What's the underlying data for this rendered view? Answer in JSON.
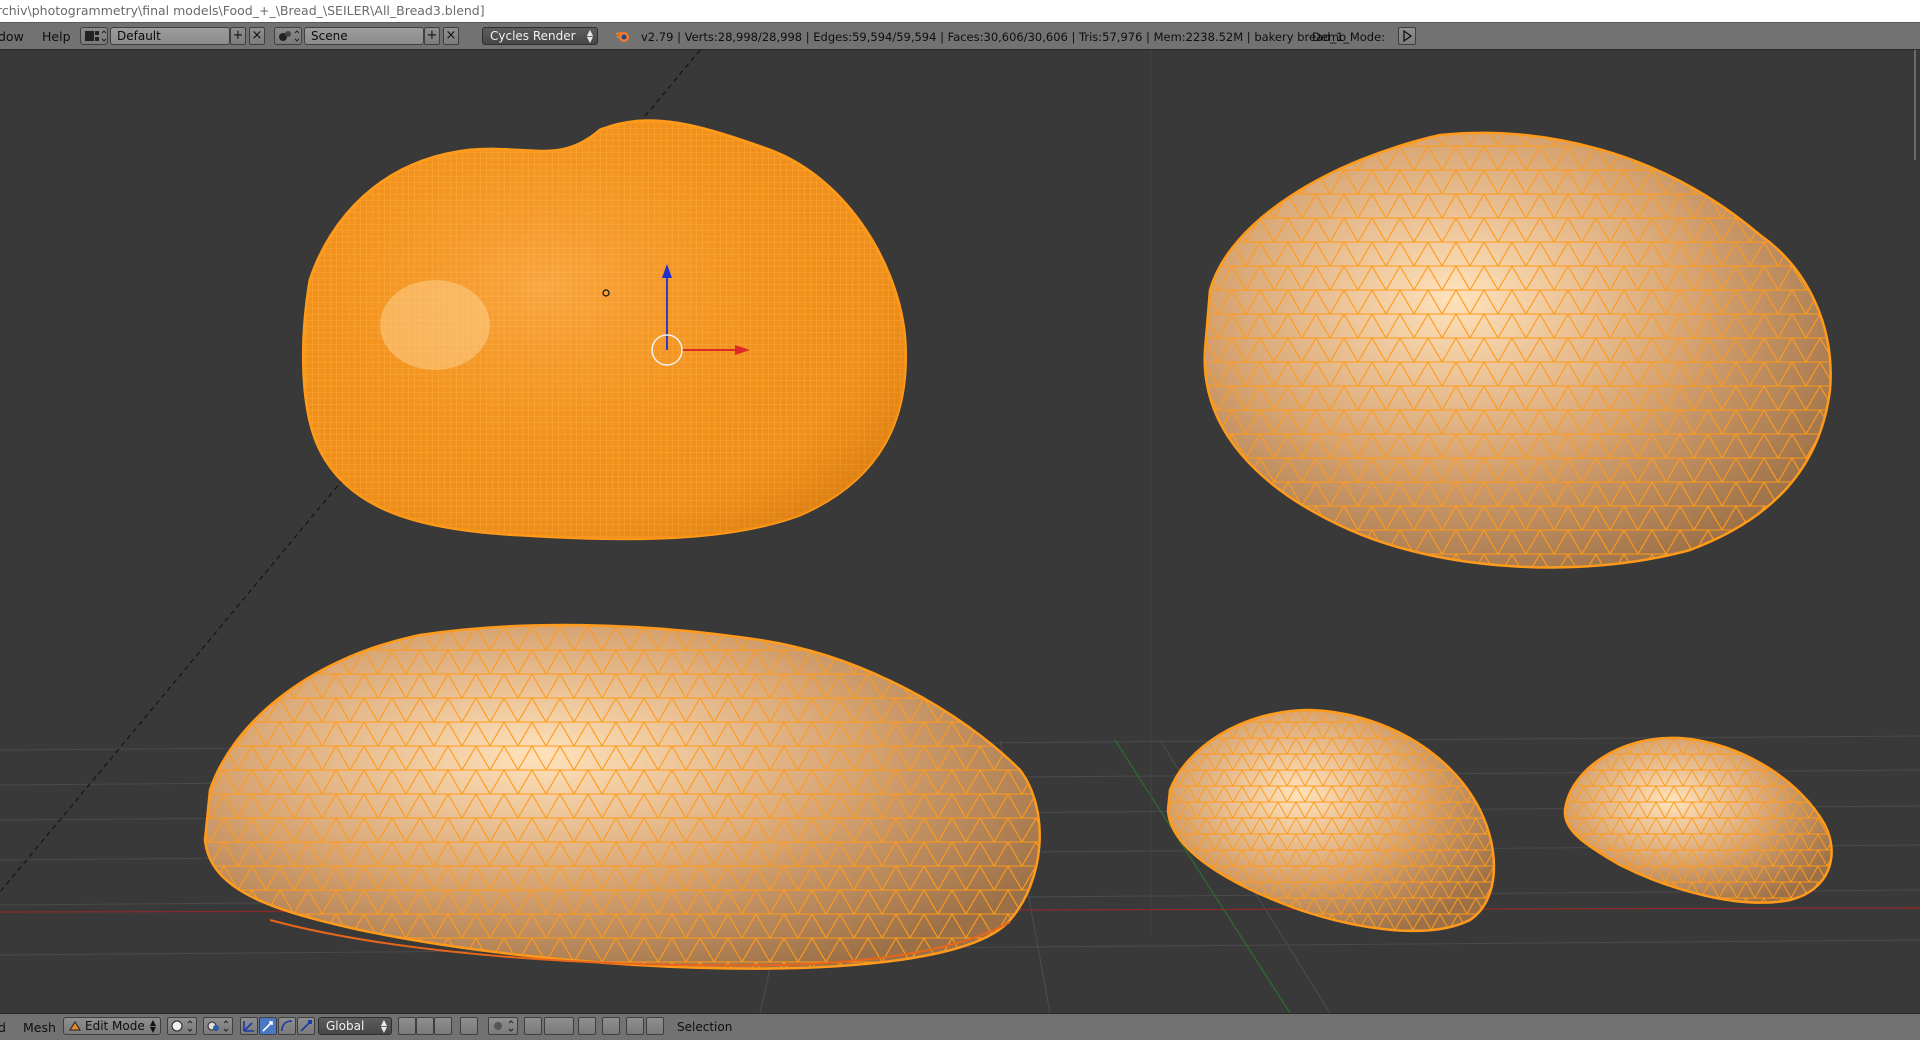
{
  "title_bar": {
    "path": "rchiv\\photogrammetry\\final models\\Food_+_\\Bread_\\SEILER\\All_Bread3.blend]"
  },
  "info_header": {
    "menus": [
      "dow",
      "Help"
    ],
    "screen_layout": "Default",
    "scene": "Scene",
    "render_engine": "Cycles Render",
    "stats": "v2.79 | Verts:28,998/28,998 | Edges:59,594/59,594 | Faces:30,606/30,606 | Tris:57,976 | Mem:2238.52M | bakery bread_1_",
    "demo_mode_label": "Demo Mode:"
  },
  "view_header": {
    "menus": [
      "d",
      "Mesh"
    ],
    "mode": "Edit Mode",
    "transform_orientation": "Global",
    "selection_label": "Selection"
  },
  "colors": {
    "viewport_bg": "#393939",
    "header_bg": "#727272",
    "selected_wire": "#ff9a1a",
    "mesh_face": "#e2b07a",
    "axis_x": "#e02a2a",
    "axis_y": "#3a8a2a"
  },
  "icons": [
    "blender-logo-icon",
    "screen-layout-icon",
    "scene-icon",
    "add-icon",
    "close-icon",
    "play-icon",
    "mode-icon",
    "shading-icon",
    "pivot-icon",
    "manipulator-icon",
    "snap-icon",
    "layer-icon"
  ]
}
